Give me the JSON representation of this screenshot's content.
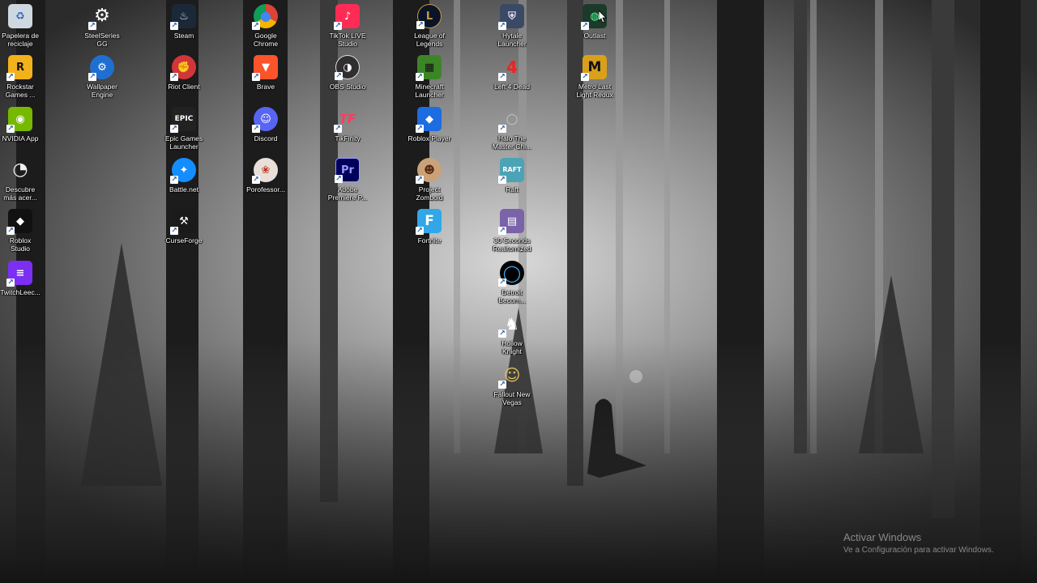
{
  "desktop": {
    "icons": [
      {
        "id": "recycle-bin",
        "label": "Papelera de\nreciclaje",
        "icon": "recycle-bin-icon",
        "bg": "#cfd8e0",
        "glyph": "♻",
        "fg": "#2e6fbf",
        "shortcut": false
      },
      {
        "id": "rockstar",
        "label": "Rockstar\nGames ...",
        "icon": "rockstar-icon",
        "bg": "#f2b21b",
        "glyph": "R",
        "fg": "#111"
      },
      {
        "id": "nvidia",
        "label": "NVIDIA App",
        "icon": "nvidia-icon",
        "bg": "#76b900",
        "glyph": "◉",
        "fg": "#fff"
      },
      {
        "id": "descubre",
        "label": "Descubre\nmás acer...",
        "icon": "compass-icon",
        "bg": "transparent",
        "glyph": "◔",
        "fg": "#eee"
      },
      {
        "id": "roblox-studio",
        "label": "Roblox\nStudio",
        "icon": "roblox-studio-icon",
        "bg": "#111",
        "glyph": "◆",
        "fg": "#fff"
      },
      {
        "id": "twitchleecher",
        "label": "TwitchLeec...",
        "icon": "twitch-leecher-icon",
        "bg": "#7b2ff2",
        "glyph": "≡",
        "fg": "#fff"
      },
      {
        "id": "steelseries",
        "label": "SteelSeries\nGG",
        "icon": "steelseries-icon",
        "bg": "transparent",
        "glyph": "⚙",
        "fg": "#fff"
      },
      {
        "id": "wallpaper-engine",
        "label": "Wallpaper\nEngine",
        "icon": "wallpaper-engine-icon",
        "bg": "#1f6fd1",
        "glyph": "⚙",
        "fg": "#fff"
      },
      {
        "id": "steam",
        "label": "Steam",
        "icon": "steam-icon",
        "bg": "#1b2838",
        "glyph": "♨",
        "fg": "#cfe3f5"
      },
      {
        "id": "riot-client",
        "label": "Riot Client",
        "icon": "riot-client-icon",
        "bg": "#d13639",
        "glyph": "✊",
        "fg": "#fff"
      },
      {
        "id": "epic-games",
        "label": "Epic Games\nLauncher",
        "icon": "epic-games-icon",
        "bg": "#222",
        "glyph": "EPIC",
        "fg": "#fff"
      },
      {
        "id": "battlenet",
        "label": "Battle.net",
        "icon": "battlenet-icon",
        "bg": "#148eff",
        "glyph": "✦",
        "fg": "#fff"
      },
      {
        "id": "curseforge",
        "label": "CurseForge",
        "icon": "curseforge-icon",
        "bg": "#1a1a1a",
        "glyph": "⚒",
        "fg": "#fff"
      },
      {
        "id": "chrome",
        "label": "Google\nChrome",
        "icon": "chrome-icon",
        "bg": "#db4437",
        "glyph": "◎",
        "fg": "#fff"
      },
      {
        "id": "brave",
        "label": "Brave",
        "icon": "brave-icon",
        "bg": "#fb542b",
        "glyph": "▼",
        "fg": "#fff"
      },
      {
        "id": "discord",
        "label": "Discord",
        "icon": "discord-icon",
        "bg": "#5865f2",
        "glyph": "☺",
        "fg": "#fff"
      },
      {
        "id": "porofessor",
        "label": "Porofessor...",
        "icon": "porofessor-icon",
        "bg": "#e8e0d8",
        "glyph": "❀",
        "fg": "#c0392b"
      },
      {
        "id": "tiktok-live",
        "label": "TikTok LIVE\nStudio",
        "icon": "tiktok-live-icon",
        "bg": "#fe2c55",
        "glyph": "♪",
        "fg": "#fff"
      },
      {
        "id": "obs",
        "label": "OBS Studio",
        "icon": "obs-icon",
        "bg": "#302e31",
        "glyph": "◑",
        "fg": "#fff"
      },
      {
        "id": "tikfinity",
        "label": "TikFinity",
        "icon": "tikfinity-icon",
        "bg": "transparent",
        "glyph": "TF",
        "fg": "#ff3b5c"
      },
      {
        "id": "premiere",
        "label": "Adobe\nPremiere P...",
        "icon": "premiere-icon",
        "bg": "#00005b",
        "glyph": "Pr",
        "fg": "#9999ff"
      },
      {
        "id": "league",
        "label": "League of\nLegends",
        "icon": "league-icon",
        "bg": "#0a1428",
        "glyph": "L",
        "fg": "#c89b3c"
      },
      {
        "id": "minecraft",
        "label": "Minecraft\nLauncher",
        "icon": "minecraft-icon",
        "bg": "#3c8527",
        "glyph": "▦",
        "fg": "#111"
      },
      {
        "id": "roblox-player",
        "label": "Roblox Player",
        "icon": "roblox-player-icon",
        "bg": "#1d6ce0",
        "glyph": "◆",
        "fg": "#fff"
      },
      {
        "id": "project-zomboid",
        "label": "Project\nZomboid",
        "icon": "project-zomboid-icon",
        "bg": "#c9a27a",
        "glyph": "☻",
        "fg": "#5a2a12"
      },
      {
        "id": "fortnite",
        "label": "Fortnite",
        "icon": "fortnite-icon",
        "bg": "#2fa7e8",
        "glyph": "F",
        "fg": "#fff"
      },
      {
        "id": "hytale",
        "label": "Hytale\nLauncher",
        "icon": "hytale-icon",
        "bg": "#3a4a66",
        "glyph": "⛨",
        "fg": "#dde"
      },
      {
        "id": "left4dead",
        "label": "Left 4 Dead",
        "icon": "left4dead-icon",
        "bg": "transparent",
        "glyph": "4",
        "fg": "#e22"
      },
      {
        "id": "halo",
        "label": "Halo The\nMaster Chi...",
        "icon": "halo-icon",
        "bg": "transparent",
        "glyph": "◯",
        "fg": "#ccc"
      },
      {
        "id": "raft",
        "label": "Raft",
        "icon": "raft-icon",
        "bg": "#4ba3b5",
        "glyph": "RAFT",
        "fg": "#fff"
      },
      {
        "id": "30-seconds",
        "label": "30 Seconds\nRealtomized",
        "icon": "30-seconds-icon",
        "bg": "#7a63a8",
        "glyph": "▤",
        "fg": "#fff"
      },
      {
        "id": "detroit",
        "label": "Detroit\nBecom...",
        "icon": "detroit-icon",
        "bg": "#000",
        "glyph": "◯",
        "fg": "#3fa9f5"
      },
      {
        "id": "hollow-knight",
        "label": "Hollow\nKnight",
        "icon": "hollow-knight-icon",
        "bg": "transparent",
        "glyph": "♞",
        "fg": "#fff"
      },
      {
        "id": "fallout",
        "label": "Fallout New\nVegas",
        "icon": "fallout-icon",
        "bg": "transparent",
        "glyph": "☺",
        "fg": "#e3c15a"
      },
      {
        "id": "outlast",
        "label": "Outlast",
        "icon": "outlast-icon",
        "bg": "#1b3a2a",
        "glyph": "◍",
        "fg": "#5f9"
      },
      {
        "id": "metro",
        "label": "Metro Last\nLight Redux",
        "icon": "metro-icon",
        "bg": "#d9a11b",
        "glyph": "M",
        "fg": "#111"
      }
    ]
  },
  "watermark": {
    "title": "Activar Windows",
    "subtitle": "Ve a Configuración para activar Windows."
  }
}
